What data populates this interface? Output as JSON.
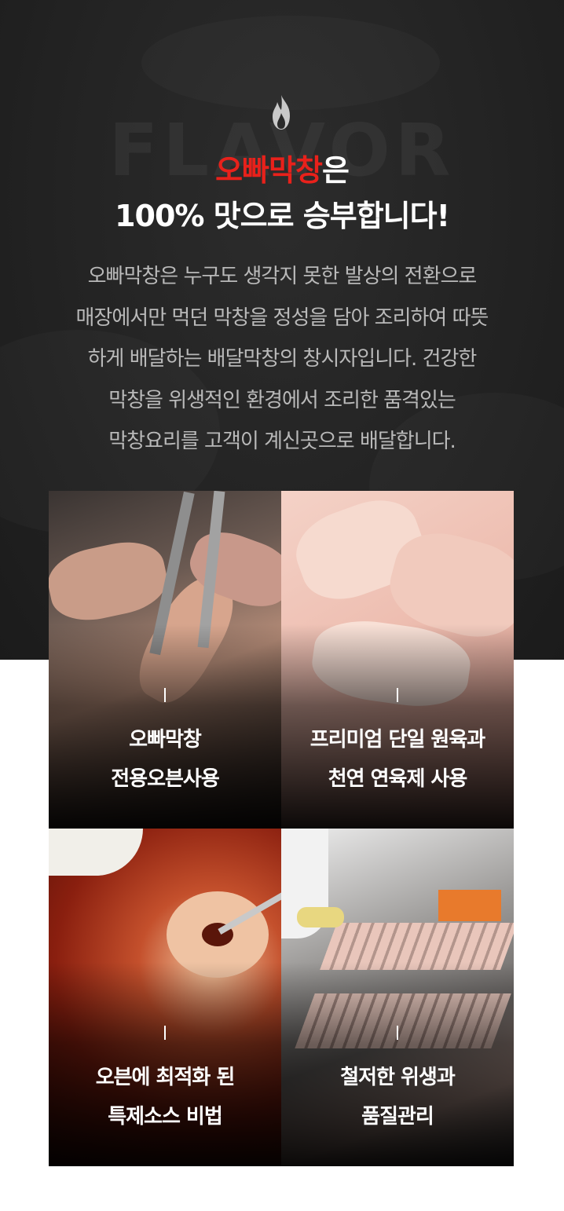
{
  "hero": {
    "watermark": "FLAVOR",
    "headline_brand": "오빠막창",
    "headline_suffix": "은",
    "headline_line2": "100% 맛으로 승부합니다!",
    "description_lines": [
      "오빠막창은 누구도 생각지 못한 발상의 전환으로",
      "매장에서만 먹던 막창을  정성을 담아 조리하여 따뜻",
      "하게 배달하는 배달막창의 창시자입니다. 건강한",
      "막창을 위생적인 환경에서 조리한 품격있는",
      "막창요리를 고객이 계신곳으로 배달합니다."
    ],
    "brand_color": "#e8211b"
  },
  "features": [
    {
      "line1": "오빠막창",
      "line2": "전용오븐사용"
    },
    {
      "line1": "프리미엄 단일 원육과",
      "line2": "천연 연육제 사용"
    },
    {
      "line1": "오븐에 최적화 된",
      "line2": "특제소스 비법"
    },
    {
      "line1": "철저한 위생과",
      "line2": "품질관리"
    }
  ],
  "icons": {
    "flame": "flame-icon"
  }
}
